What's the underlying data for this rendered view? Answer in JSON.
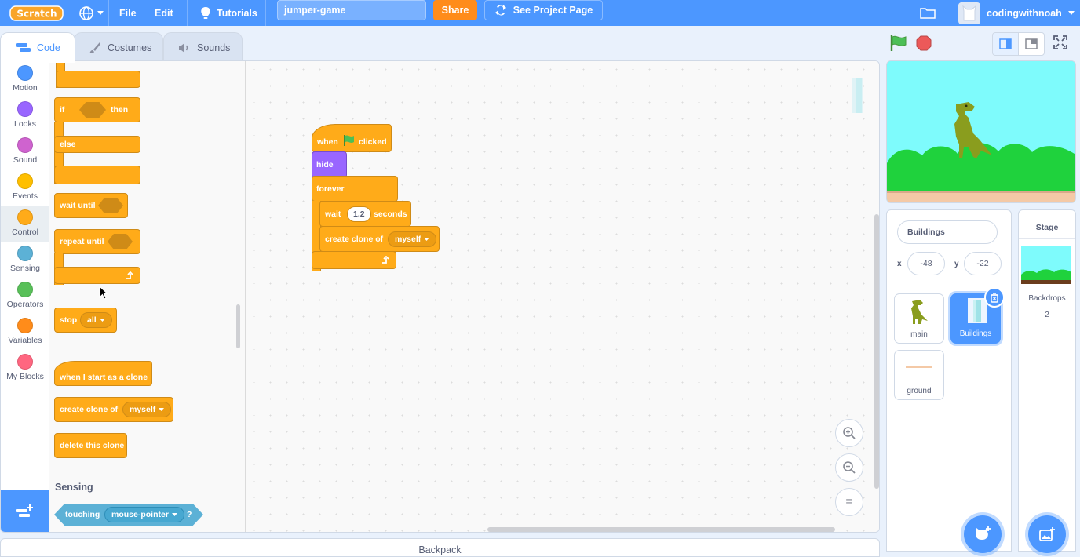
{
  "menubar": {
    "logo": "Scratch",
    "file": "File",
    "edit": "Edit",
    "tutorials": "Tutorials",
    "project_title": "jumper-game",
    "share": "Share",
    "see_project_page": "See Project Page",
    "username": "codingwithnoah",
    "icons": [
      "globe-icon",
      "lightbulb-icon",
      "remix-icon",
      "folder-icon",
      "avatar",
      "chevron-down-icon"
    ]
  },
  "tabs": [
    {
      "label": "Code",
      "active": true,
      "icon": "code-icon"
    },
    {
      "label": "Costumes",
      "active": false,
      "icon": "brush-icon"
    },
    {
      "label": "Sounds",
      "active": false,
      "icon": "speaker-icon"
    }
  ],
  "categories": [
    {
      "label": "Motion",
      "color": "#4c97ff"
    },
    {
      "label": "Looks",
      "color": "#9966ff"
    },
    {
      "label": "Sound",
      "color": "#cf63cf"
    },
    {
      "label": "Events",
      "color": "#ffbf00"
    },
    {
      "label": "Control",
      "color": "#ffab19"
    },
    {
      "label": "Sensing",
      "color": "#5cb1d6"
    },
    {
      "label": "Operators",
      "color": "#59c059"
    },
    {
      "label": "Variables",
      "color": "#ff8c1a"
    },
    {
      "label": "My Blocks",
      "color": "#ff6680"
    }
  ],
  "palette": {
    "if": "if",
    "then": "then",
    "else": "else",
    "wait_until": "wait until",
    "repeat_until": "repeat until",
    "stop": "stop",
    "stop_option": "all",
    "when_clone": "when I start as a clone",
    "create_clone": "create clone of",
    "clone_option": "myself",
    "delete_clone": "delete this clone",
    "sensing_heading": "Sensing",
    "touching": "touching",
    "touching_option": "mouse-pointer",
    "touching_q": "?"
  },
  "script": {
    "when": "when",
    "clicked": "clicked",
    "hide": "hide",
    "forever": "forever",
    "wait": "wait",
    "wait_value": "1.2",
    "seconds": "seconds",
    "create_clone": "create clone of",
    "clone_option": "myself"
  },
  "zoom": {
    "in": "+",
    "out": "−",
    "reset": "="
  },
  "sprite_info": {
    "name": "Buildings",
    "x_label": "x",
    "x_value": "-48",
    "y_label": "y",
    "y_value": "-22"
  },
  "sprites": [
    {
      "name": "main",
      "selected": false
    },
    {
      "name": "Buildings",
      "selected": true
    },
    {
      "name": "ground",
      "selected": false
    }
  ],
  "stage_pane": {
    "title": "Stage",
    "backdrops_label": "Backdrops",
    "backdrops_count": "2"
  },
  "backpack": "Backpack",
  "colors": {
    "accent": "#4c97ff",
    "control": "#ffab19",
    "looks": "#9966ff",
    "share": "#ff8c1a",
    "green_flag": "#45993d",
    "stop": "#ec5959"
  }
}
